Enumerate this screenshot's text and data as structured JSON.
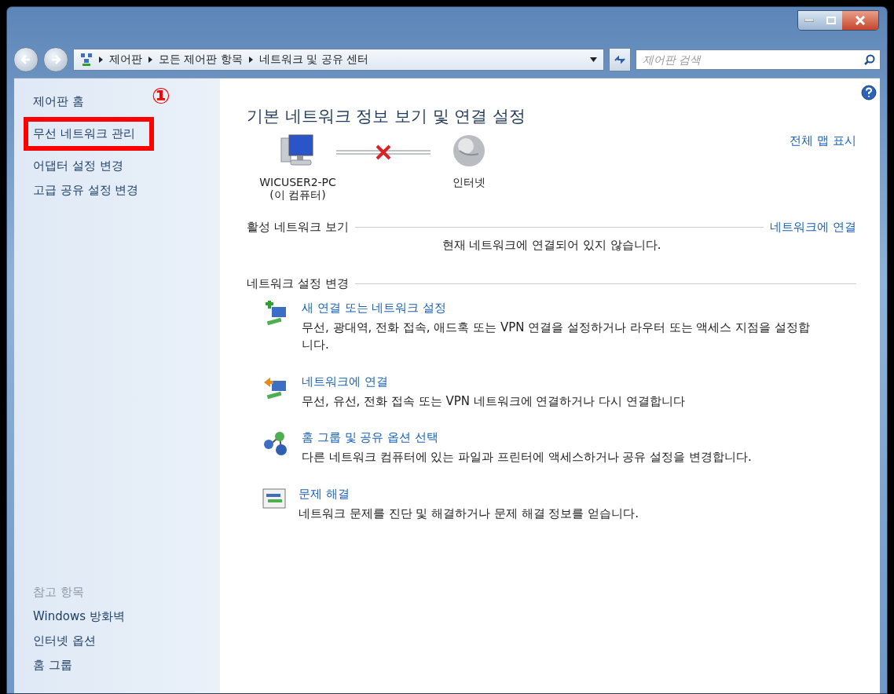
{
  "address_bar": {
    "path": [
      "제어판",
      "모든 제어판 항목",
      "네트워크 및 공유 센터"
    ]
  },
  "search": {
    "placeholder": "제어판 검색"
  },
  "annotation": {
    "label": "①"
  },
  "sidebar": {
    "items": [
      {
        "label": "제어판 홈",
        "highlighted": false
      },
      {
        "label": "무선 네트워크 관리",
        "highlighted": true
      },
      {
        "label": "어댑터 설정 변경",
        "highlighted": false
      },
      {
        "label": "고급 공유 설정 변경",
        "highlighted": false
      }
    ],
    "see_also": {
      "title": "참고 항목",
      "items": [
        "Windows 방화벽",
        "인터넷 옵션",
        "홈 그룹"
      ]
    }
  },
  "main": {
    "title": "기본 네트워크 정보 보기 및 연결 설정",
    "map_link": "전체 맵 표시",
    "nodes": [
      {
        "kind": "computer",
        "label": "WICUSER2-PC",
        "sublabel": "(이 컴퓨터)"
      },
      {
        "kind": "internet",
        "label": "인터넷"
      }
    ],
    "connected": false,
    "active_networks": {
      "heading": "활성 네트워크 보기",
      "link": "네트워크에 연결",
      "status": "현재 네트워크에 연결되어 있지 않습니다."
    },
    "settings": {
      "heading": "네트워크 설정 변경",
      "tasks": [
        {
          "kind": "new",
          "title": "새 연결 또는 네트워크 설정",
          "description": "무선, 광대역, 전화 접속, 애드혹 또는 VPN 연결을 설정하거나 라우터 또는 액세스 지점을 설정합니다."
        },
        {
          "kind": "connect",
          "title": "네트워크에 연결",
          "description": "무선, 유선, 전화 접속 또는 VPN 네트워크에 연결하거나 다시 연결합니다"
        },
        {
          "kind": "homegroup",
          "title": "홈 그룹 및 공유 옵션 선택",
          "description": "다른 네트워크 컴퓨터에 있는 파일과 프린터에 액세스하거나 공유 설정을 변경합니다."
        },
        {
          "kind": "troubleshoot",
          "title": "문제 해결",
          "description": "네트워크 문제를 진단 및 해결하거나 문제 해결 정보를 얻습니다."
        }
      ]
    }
  }
}
